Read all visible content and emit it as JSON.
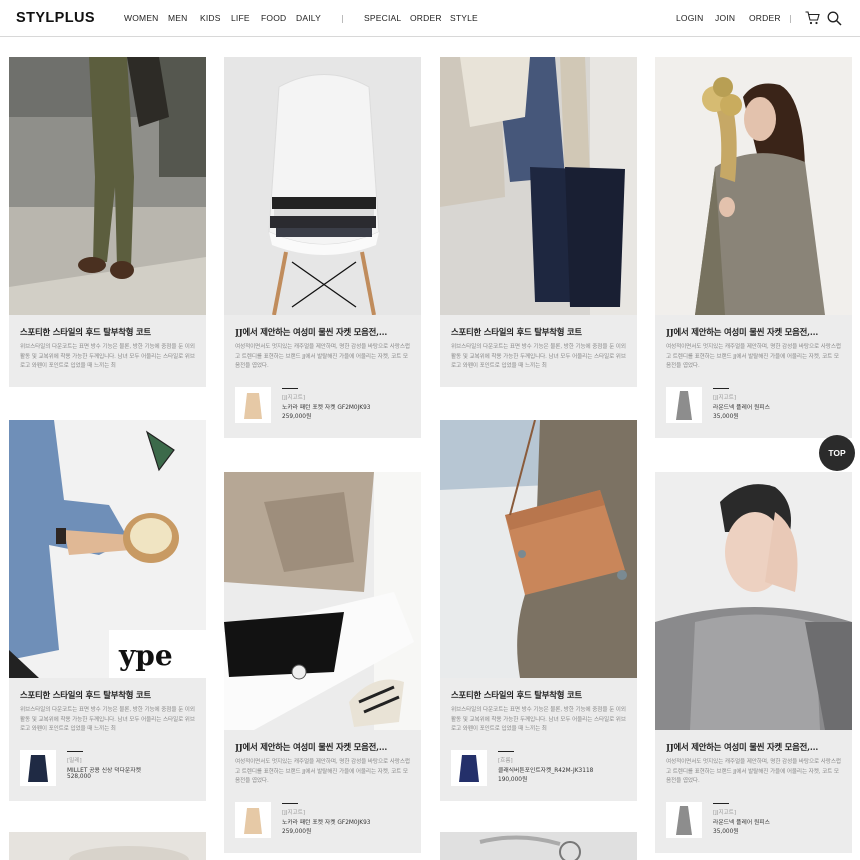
{
  "header": {
    "logo": "STYLPLUS",
    "nav_left": [
      "WOMEN",
      "MEN",
      "KIDS",
      "LIFE",
      "FOOD",
      "DAILY"
    ],
    "nav_mid": [
      "SPECIAL",
      "ORDER",
      "STYLE"
    ],
    "nav_right": [
      "LOGIN",
      "JOIN",
      "ORDER"
    ],
    "icons": [
      "cart-icon",
      "search-icon"
    ]
  },
  "cards": [
    {
      "title": "스포티한 스타일의 후드 탈부착형 코트",
      "desc": "위브스타일의 다운코트는 표면 방수 기능은 물론, 방한 기능에 중점을 둔 이외 활동 및 교복위에 착용 가능한 두께입니다. 남녀 모두 어울리는 스타일로 위브로고 와펜이 포인트로 입었을 때 느끼는 최"
    },
    {
      "title": "JJ에서 제안하는 여성미 물씬 자켓 모음전,...",
      "desc": "여성적이면서도 멋지있는 캐주얼을 제안하며, 명한 감성을 바탕으로 사랑스럽고 트렌디를 표현하는 브랜드 JJ에서 발랄해진 가을에 어울리는 자켓, 코트 모음전을 엽었다.",
      "product": {
        "cat": "[JJ지고트]",
        "name": "노카라 패턴 포켓 자켓 GF2M0JK93",
        "price": "259,000원"
      }
    },
    {
      "title": "스포티한 스타일의 후드 탈부착형 코트",
      "desc": "위브스타일의 다운코트는 표면 방수 기능은 물론, 방한 기능에 중점을 둔 이외 활동 및 교복위에 착용 가능한 두께입니다. 남녀 모두 어울리는 스타일로 위브로고 와펜이 포인트로 입었을 때 느끼는 최"
    },
    {
      "title": "JJ에서 제안하는 여성미 물씬 자켓 모음전,...",
      "desc": "여성적이면서도 멋지있는 캐주얼을 제안하며, 명한 감성을 바탕으로 사랑스럽고 트렌디를 표현하는 브랜드 JJ에서 발랄해진 가을에 어울리는 자켓, 코트 모음전을 엽었다.",
      "product": {
        "cat": "[JJ지고트]",
        "name": "라운드넥 플레어 원피스",
        "price": "35,000원"
      }
    },
    {
      "title": "스포티한 스타일의 후드 탈부착형 코트",
      "desc": "위브스타일의 다운코트는 표면 방수 기능은 물론, 방한 기능에 중점을 둔 이외 활동 및 교복위에 착용 가능한 두께입니다. 남녀 모두 어울리는 스타일로 위브로고 와펜이 포인트로 입었을 때 느끼는 최",
      "product": {
        "cat": "[밀레]",
        "name": "MILLET 공용 신상 덕다운자켓",
        "price": "528,000"
      }
    },
    {
      "title": "JJ에서 제안하는 여성미 물씬 자켓 모음전,...",
      "desc": "여성적이면서도 멋지있는 캐주얼을 제안하며, 명한 감성을 바탕으로 사랑스럽고 트렌디를 표현하는 브랜드 JJ에서 발랄해진 가을에 어울리는 자켓, 코트 모음전을 엽었다.",
      "product": {
        "cat": "[JJ지고트]",
        "name": "노카라 패턴 포켓 자켓 GF2M0JK93",
        "price": "259,000원"
      }
    },
    {
      "title": "스포티한 스타일의 후드 탈부착형 코트",
      "desc": "위브스타일의 다운코트는 표면 방수 기능은 물론, 방한 기능에 중점을 둔 이외 활동 및 교복위에 착용 가능한 두께입니다. 남녀 모두 어울리는 스타일로 위브로고 와펜이 포인트로 입었을 때 느끼는 최",
      "product": {
        "cat": "[흐름]",
        "name": "클래식버튼포인트자켓_R42M-JK3118",
        "price": "190,000원"
      }
    },
    {
      "title": "JJ에서 제안하는 여성미 물씬 자켓 모음전,...",
      "desc": "여성적이면서도 멋지있는 캐주얼을 제안하며, 명한 감성을 바탕으로 사랑스럽고 트렌디를 표현하는 브랜드 JJ에서 발랄해진 가을에 어울리는 자켓, 코트 모음전을 엽었다.",
      "product": {
        "cat": "[JJ지고트]",
        "name": "라운드넥 플레어 원피스",
        "price": "35,000원"
      }
    }
  ],
  "top_button": "TOP",
  "colors": {
    "card_bg": "#ececec",
    "top_bg": "#2b2b2b",
    "text": "#222222"
  }
}
